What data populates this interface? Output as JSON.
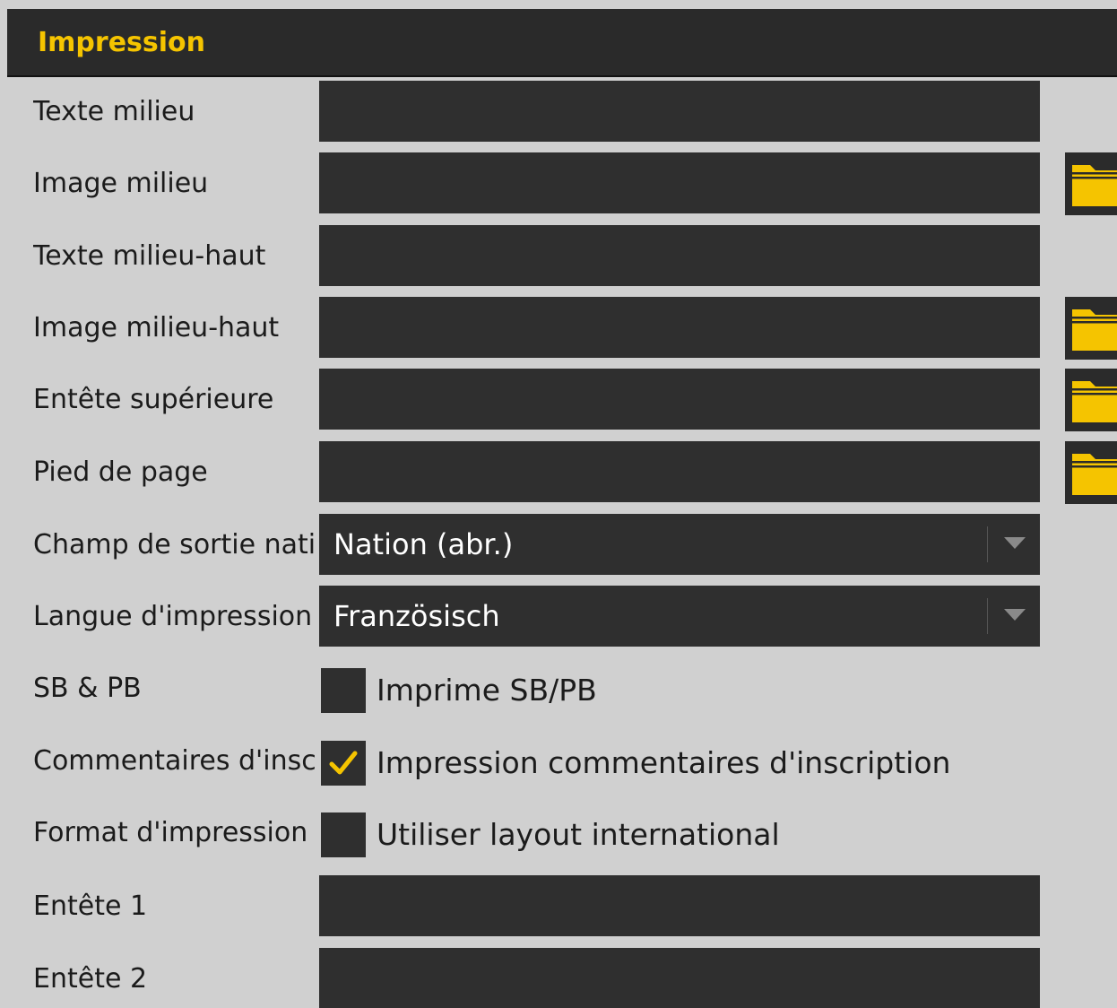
{
  "panel": {
    "title": "Impression"
  },
  "fields": {
    "texte_milieu": {
      "label": "Texte milieu",
      "value": ""
    },
    "image_milieu": {
      "label": "Image milieu",
      "value": ""
    },
    "texte_milieu_haut": {
      "label": "Texte milieu-haut",
      "value": ""
    },
    "image_milieu_haut": {
      "label": "Image milieu-haut",
      "value": ""
    },
    "entete_superieure": {
      "label": "Entête supérieure",
      "value": ""
    },
    "pied_de_page": {
      "label": "Pied de page",
      "value": ""
    },
    "champ_sortie_nation": {
      "label": "Champ de sortie nati",
      "selected": "Nation (abr.)"
    },
    "langue_impression": {
      "label": "Langue d'impression",
      "selected": "Französisch"
    },
    "sb_pb": {
      "label": "SB & PB",
      "checkbox_label": "Imprime SB/PB",
      "checked": false
    },
    "commentaires_inscription": {
      "label": "Commentaires d'insc",
      "checkbox_label": "Impression commentaires d'inscription",
      "checked": true
    },
    "format_impression": {
      "label": "Format d'impression",
      "checkbox_label": "Utiliser layout international",
      "checked": false
    },
    "entete_1": {
      "label": "Entête 1",
      "value": ""
    },
    "entete_2": {
      "label": "Entête 2",
      "value": ""
    }
  },
  "icons": {
    "folder": "folder-icon",
    "dropdown": "chevron-down-icon",
    "check": "checkmark-icon"
  },
  "colors": {
    "header_background": "#2a2a2a",
    "header_text": "#f5c400",
    "panel_background": "#d0d0d0",
    "field_background": "#2f2f2f",
    "folder_icon": "#f5c400",
    "checkmark": "#f5c400"
  }
}
